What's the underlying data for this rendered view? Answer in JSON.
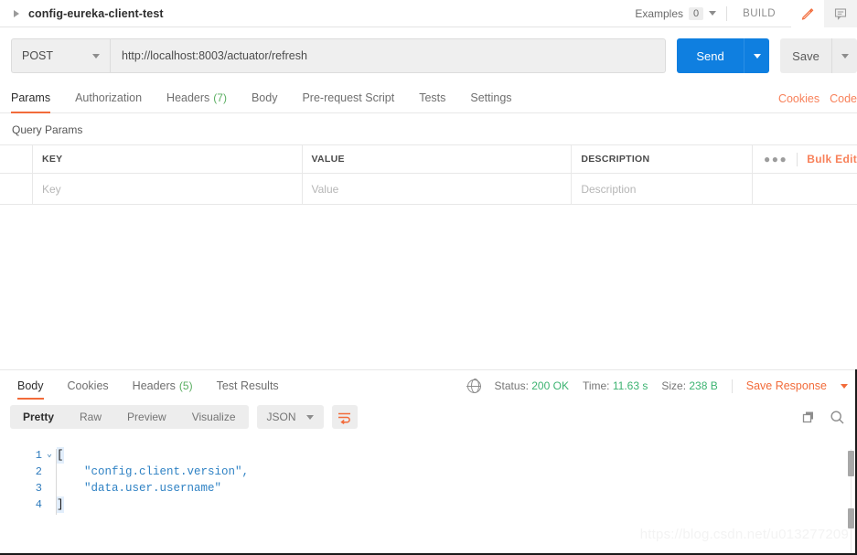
{
  "topbar": {
    "tab_title": "config-eureka-client-test",
    "expand_icon": "caret-right-icon",
    "examples_label": "Examples",
    "examples_count": "0",
    "build_label": "BUILD",
    "edit_icon": "pencil-icon",
    "comment_icon": "comment-icon"
  },
  "request": {
    "method": "POST",
    "url": "http://localhost:8003/actuator/refresh",
    "send_label": "Send",
    "save_label": "Save"
  },
  "request_tabs": {
    "items": [
      {
        "label": "Params",
        "count": "",
        "active": true
      },
      {
        "label": "Authorization",
        "count": "",
        "active": false
      },
      {
        "label": "Headers",
        "count": "(7)",
        "active": false
      },
      {
        "label": "Body",
        "count": "",
        "active": false
      },
      {
        "label": "Pre-request Script",
        "count": "",
        "active": false
      },
      {
        "label": "Tests",
        "count": "",
        "active": false
      },
      {
        "label": "Settings",
        "count": "",
        "active": false
      }
    ],
    "cookies_label": "Cookies",
    "code_label": "Code"
  },
  "query_params": {
    "section_label": "Query Params",
    "headers": [
      "KEY",
      "VALUE",
      "DESCRIPTION"
    ],
    "more_icon": "ellipsis-icon",
    "bulk_edit_label": "Bulk Edit",
    "rows": [
      {
        "key": "Key",
        "value": "Value",
        "description": "Description"
      }
    ]
  },
  "response": {
    "tabs": [
      {
        "label": "Body",
        "count": "",
        "active": true
      },
      {
        "label": "Cookies",
        "count": "",
        "active": false
      },
      {
        "label": "Headers",
        "count": "(5)",
        "active": false
      },
      {
        "label": "Test Results",
        "count": "",
        "active": false
      }
    ],
    "globe_icon": "globe-icon",
    "status_label": "Status:",
    "status_value": "200 OK",
    "time_label": "Time:",
    "time_value": "11.63 s",
    "size_label": "Size:",
    "size_value": "238 B",
    "save_response_label": "Save Response",
    "toolbar": {
      "views": [
        {
          "label": "Pretty",
          "active": true
        },
        {
          "label": "Raw",
          "active": false
        },
        {
          "label": "Preview",
          "active": false
        },
        {
          "label": "Visualize",
          "active": false
        }
      ],
      "format": "JSON",
      "wrap_icon": "word-wrap-icon",
      "copy_icon": "copy-icon",
      "search_icon": "search-icon"
    },
    "body_lines": [
      {
        "num": "1",
        "fold": "⌄",
        "text": "[",
        "type": "bracket"
      },
      {
        "num": "2",
        "fold": "",
        "text": "    \"config.client.version\",",
        "type": "string"
      },
      {
        "num": "3",
        "fold": "",
        "text": "    \"data.user.username\"",
        "type": "string"
      },
      {
        "num": "4",
        "fold": "",
        "text": "]",
        "type": "bracket"
      }
    ]
  },
  "watermark": "https://blog.csdn.net/u013277209",
  "colors": {
    "accent_orange": "#f26b3a",
    "link_orange": "#f8815a",
    "send_blue": "#0f7fe0",
    "status_green": "#3cb371",
    "count_green": "#5aae61",
    "json_blue": "#2f82c4"
  }
}
